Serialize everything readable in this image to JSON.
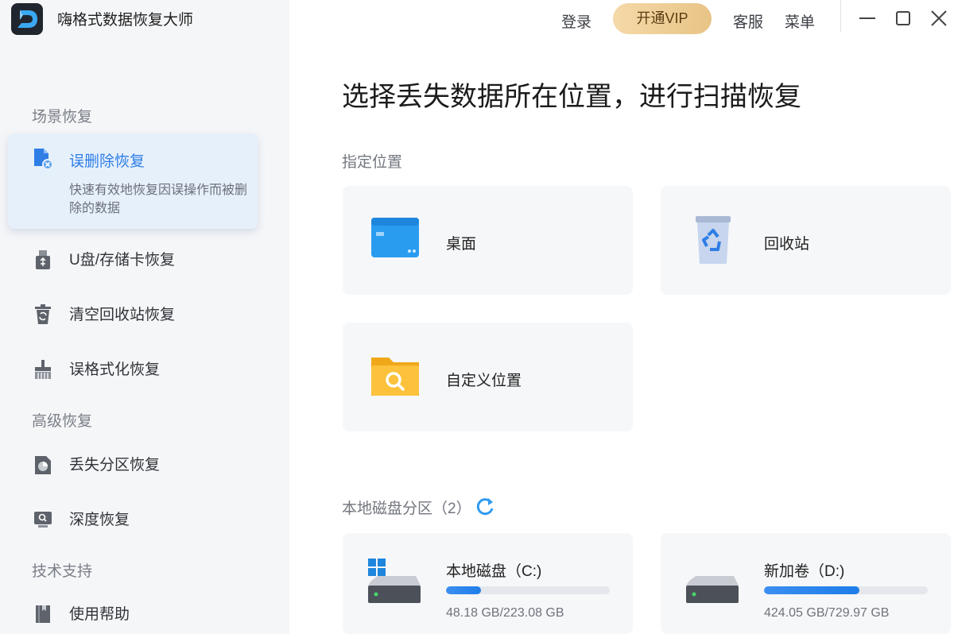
{
  "app": {
    "title": "嗨格式数据恢复大师",
    "logo_letter": "D"
  },
  "topbar": {
    "login": "登录",
    "vip": "开通VIP",
    "service": "客服",
    "menu": "菜单"
  },
  "sidebar": {
    "section_scene": "场景恢复",
    "section_advanced": "高级恢复",
    "section_support": "技术支持",
    "items": [
      {
        "label": "误删除恢复",
        "desc": "快速有效地恢复因误操作而被删除的数据",
        "icon": "file-delete-icon",
        "active": true
      },
      {
        "label": "U盘/存储卡恢复",
        "icon": "usb-icon"
      },
      {
        "label": "清空回收站恢复",
        "icon": "recycle-bin-icon"
      },
      {
        "label": "误格式化恢复",
        "icon": "brush-icon"
      },
      {
        "label": "丢失分区恢复",
        "icon": "partition-icon"
      },
      {
        "label": "深度恢复",
        "icon": "deep-scan-icon"
      },
      {
        "label": "使用帮助",
        "icon": "help-book-icon"
      }
    ]
  },
  "main": {
    "title": "选择丢失数据所在位置，进行扫描恢复",
    "location_label": "指定位置",
    "locations": [
      {
        "label": "桌面",
        "icon": "desktop-icon"
      },
      {
        "label": "回收站",
        "icon": "recycle-bin-icon"
      },
      {
        "label": "自定义位置",
        "icon": "folder-search-icon"
      }
    ],
    "disk_label": "本地磁盘分区（2）",
    "disks": [
      {
        "name": "本地磁盘（C:)",
        "size": "48.18 GB/223.08 GB",
        "used_fraction": 0.216
      },
      {
        "name": "新加卷（D:)",
        "size": "424.05 GB/729.97 GB",
        "used_fraction": 0.581
      }
    ]
  },
  "colors": {
    "accent": "#2f7ee6",
    "vip_gold": "#e8c486",
    "sidebar_bg": "#f5f6f8",
    "card_bg": "#f6f7f9"
  }
}
